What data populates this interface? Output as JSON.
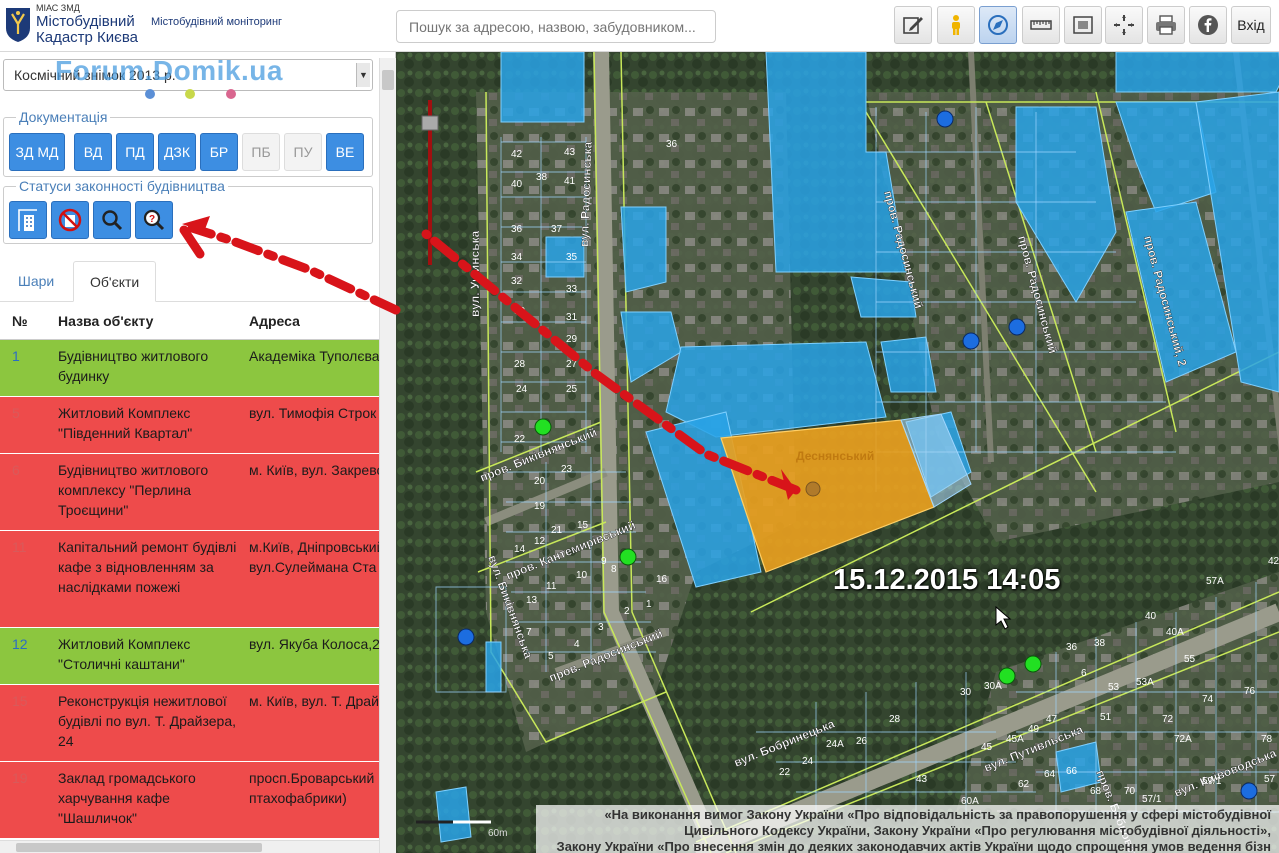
{
  "header": {
    "logo_small": "МІАС ЗМД",
    "logo_line1": "Містобудівний",
    "logo_line2": "Кадастр Києва",
    "subtitle": "Містобудівний моніторинг",
    "search_placeholder": "Пошук за адресою, назвою, забудовником...",
    "login_label": "Вхід",
    "tools": [
      {
        "icon": "edit-icon"
      },
      {
        "icon": "street-view-icon"
      },
      {
        "icon": "compass-icon",
        "active": true
      },
      {
        "icon": "ruler-icon"
      },
      {
        "icon": "area-measure-icon"
      },
      {
        "icon": "crosshair-icon"
      },
      {
        "icon": "print-icon"
      },
      {
        "icon": "facebook-icon"
      }
    ]
  },
  "sidebar": {
    "layer_select": "Космічний знімок 2013 р.",
    "watermark": "Forum.Domik.ua",
    "watermark_dots": [
      "#5b8fd6",
      "#c8d84a",
      "#d9668f"
    ],
    "documentation_title": "Документація",
    "doc_buttons": [
      {
        "label": "ЗД МД",
        "active": true
      },
      {
        "label": "ВД",
        "active": true
      },
      {
        "label": "ПД",
        "active": true
      },
      {
        "label": "ДЗК",
        "active": true
      },
      {
        "label": "БР",
        "active": true
      },
      {
        "label": "ПБ",
        "active": false
      },
      {
        "label": "ПУ",
        "active": false
      },
      {
        "label": "ВЕ",
        "active": true
      }
    ],
    "status_title": "Статуси законності будівництва",
    "status_buttons": [
      "building-crane-icon",
      "prohibited-icon",
      "magnifier-icon",
      "question-magnifier-icon"
    ],
    "tabs": [
      {
        "label": "Шари",
        "active": false
      },
      {
        "label": "Об'єкти",
        "active": true
      }
    ],
    "table": {
      "columns": [
        "№",
        "Назва об'єкту",
        "Адреса"
      ],
      "rows": [
        {
          "no": "1",
          "name": "Будівництво житлового будинку",
          "addr": [
            "Академіка Туполєва"
          ],
          "status": "green"
        },
        {
          "no": "5",
          "name": "Житловий Комплекс \"Південний Квартал\"",
          "addr": [
            "вул. Тимофія Строк"
          ],
          "status": "red"
        },
        {
          "no": "6",
          "name": "Будівництво житлового комплексу \"Перлина Троєщини\"",
          "addr": [
            "м. Київ, вул. Закрево"
          ],
          "status": "red"
        },
        {
          "no": "11",
          "name": "Капітальний ремонт будівлі кафе з відновленням за наслідками пожежі",
          "addr": [
            "м.Київ, Дніпровський",
            "вул.Сулеймана Ста"
          ],
          "status": "red"
        },
        {
          "no": "12",
          "name": "Житловий Комплекс \"Столичні каштани\"",
          "addr": [
            "вул. Якуба Колоса,2"
          ],
          "status": "green"
        },
        {
          "no": "15",
          "name": "Реконструкція нежитлової будівлі по вул. Т. Драйзера, 24",
          "addr": [
            "м. Київ, вул. Т. Драй"
          ],
          "status": "red"
        },
        {
          "no": "19",
          "name": "Заклад громадського харчування кафе \"Шашличок\"",
          "addr": [
            "просп.Броварський",
            "птахофабрики)"
          ],
          "status": "red"
        }
      ]
    }
  },
  "map": {
    "timestamp": "15.12.2015 14:05",
    "scale_label": "60m",
    "highlighted_parcel_label": "Деснянський",
    "street_labels": [
      "вул. Ушинська",
      "вул. Радосинська",
      "пров. Радосинський",
      "пров. Радосинський",
      "пров. Радосинський, 2",
      "пров. Биківнянський",
      "пров. Кантемирівський",
      "вул. Биківнянська",
      "пров. Радосинський",
      "вул. Бобринецька",
      "вул. Путивльська",
      "пров. Бобровецька",
      "вул. Київоводська"
    ],
    "plot_numbers": [
      "36",
      "42",
      "43",
      "40",
      "38",
      "41",
      "36",
      "37",
      "34",
      "35",
      "32",
      "33",
      "30",
      "31",
      "29",
      "28",
      "27",
      "24",
      "25",
      "22",
      "23",
      "20",
      "19",
      "21",
      "15",
      "14",
      "12",
      "13",
      "11",
      "10",
      "9",
      "8",
      "7",
      "5",
      "4",
      "3",
      "2",
      "1",
      "16",
      "57А",
      "40",
      "40А",
      "36",
      "38",
      "55",
      "6",
      "53",
      "53А",
      "30",
      "30А",
      "47",
      "51",
      "28",
      "26",
      "24А",
      "22",
      "24",
      "43",
      "45",
      "45А",
      "49",
      "62",
      "64",
      "66",
      "68",
      "70",
      "72",
      "72А",
      "74",
      "76",
      "78",
      "57/1",
      "59/1",
      "60А",
      "42",
      "57"
    ],
    "notice_lines": [
      "«На виконання вимог Закону України «Про відповідальність за правопорушення у сфері містобудівної",
      "Цивільного Кодексу України, Закону України «Про регулювання містобудівної діяльності»,",
      "Закону України «Про внесення змін до деяких законодавчих актів України щодо спрощення умов ведення бізн"
    ]
  },
  "colors": {
    "parcel_blue": "#29a3e8",
    "parcel_orange": "#e8a020",
    "status_green": "#8cc63f",
    "status_red": "#ee4b4b",
    "arrow_red": "#d8141a"
  }
}
